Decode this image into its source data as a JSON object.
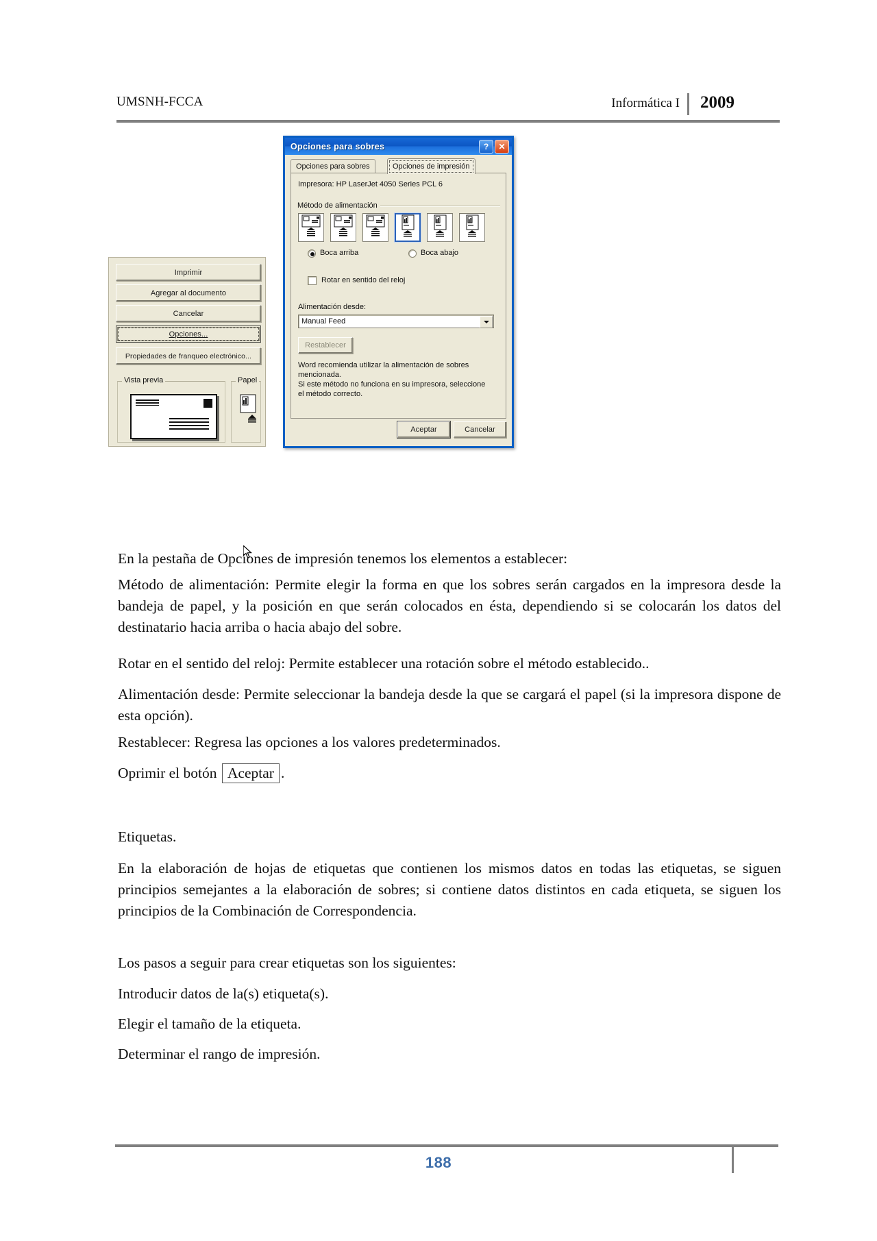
{
  "header": {
    "left": "UMSNH-FCCA",
    "course": "Informática I",
    "year": "2009"
  },
  "footer": {
    "page_number": "188",
    "page_color": "#3f6fab"
  },
  "screenshot": {
    "envelopes_dialog": {
      "buttons": [
        {
          "label": "Imprimir",
          "underline": "I",
          "state": "normal"
        },
        {
          "label": "Agregar al documento",
          "underline": "A",
          "state": "normal"
        },
        {
          "label": "Cancelar",
          "underline": "",
          "state": "normal"
        },
        {
          "label": "Opciones...",
          "underline": "O",
          "state": "focused"
        },
        {
          "label": "Propiedades de franqueo electrónico...",
          "underline": "u",
          "state": "normal"
        }
      ],
      "preview_group_label": "Vista previa",
      "paper_group_label": "Papel"
    },
    "options_dialog": {
      "title": "Opciones para sobres",
      "title_buttons": [
        {
          "name": "help",
          "glyph": "?"
        },
        {
          "name": "close",
          "glyph": "✕"
        }
      ],
      "tabs": [
        {
          "label": "Opciones para sobres",
          "underline": "p",
          "active": false
        },
        {
          "label": "Opciones de impresión",
          "underline": "c",
          "active": true
        }
      ],
      "printer_line": "Impresora: HP LaserJet 4050 Series PCL 6",
      "feed_group_label": "Método de alimentación",
      "feed_icons": [
        {
          "index": 0,
          "kind": "landscape",
          "selected": false
        },
        {
          "index": 1,
          "kind": "landscape",
          "selected": false
        },
        {
          "index": 2,
          "kind": "landscape",
          "selected": false
        },
        {
          "index": 3,
          "kind": "portrait",
          "selected": true
        },
        {
          "index": 4,
          "kind": "portrait",
          "selected": false
        },
        {
          "index": 5,
          "kind": "portrait",
          "selected": false
        }
      ],
      "face_up": {
        "label": "Boca arriba",
        "underline": "B",
        "checked": true
      },
      "face_down": {
        "label": "Boca abajo",
        "underline": "o",
        "checked": false
      },
      "rotate": {
        "label": "Rotar en sentido del reloj",
        "underline": "s",
        "checked": false
      },
      "feed_from_label": "Alimentación desde:",
      "feed_from_value": "Manual Feed",
      "reset_button": {
        "label": "Restablecer",
        "enabled": false
      },
      "note_lines": [
        "Word recomienda utilizar la alimentación de sobres",
        "mencionada.",
        "Si este método no funciona en su impresora, seleccione",
        "el método correcto."
      ],
      "ok_button": "Aceptar",
      "cancel_button": "Cancelar",
      "accent_color": "#0a5fc4"
    }
  },
  "body": {
    "p1": "En la pestaña de Opciones de impresión tenemos los elementos a establecer:",
    "p2": "Método de alimentación: Permite elegir la forma en que los sobres serán cargados en la impresora desde la bandeja de papel, y la posición en que serán colocados en ésta, dependiendo si se colocarán los datos del destinatario hacia arriba o hacia abajo del sobre.",
    "p3": "Rotar en el sentido del reloj: Permite establecer una rotación sobre el método establecido..",
    "p4": "Alimentación desde: Permite seleccionar la bandeja desde la que se cargará el papel (si la impresora dispone de esta opción).",
    "p5": "Restablecer: Regresa las opciones a los valores predeterminados.",
    "p6_before": "Oprimir el botón",
    "p6_button": "Aceptar",
    "p6_after": ".",
    "p7": "Etiquetas.",
    "p8": "En la elaboración de hojas de etiquetas que contienen los mismos datos en todas las etiquetas, se siguen principios semejantes a la elaboración de sobres; si contiene datos distintos en cada etiqueta, se siguen los principios de la Combinación de Correspondencia.",
    "p9": "Los pasos a seguir para crear etiquetas son los siguientes:",
    "p10": "Introducir datos de la(s) etiqueta(s).",
    "p11": "Elegir el tamaño de la etiqueta.",
    "p12": "Determinar el rango de impresión."
  }
}
